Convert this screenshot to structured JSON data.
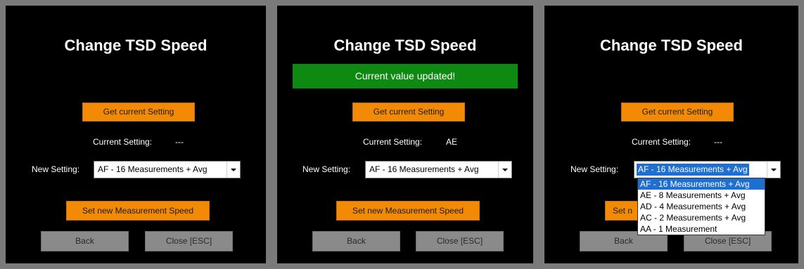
{
  "panels": [
    {
      "title": "Change TSD Speed",
      "get_button": "Get current Setting",
      "current_label": "Current Setting:",
      "current_value": "---",
      "new_label": "New Setting:",
      "selected": "AF - 16 Measurements + Avg",
      "set_button": "Set new Measurement Speed",
      "back_button": "Back",
      "close_button": "Close [ESC]"
    },
    {
      "title": "Change TSD Speed",
      "banner": "Current value updated!",
      "get_button": "Get current Setting",
      "current_label": "Current Setting:",
      "current_value": "AE",
      "new_label": "New Setting:",
      "selected": "AF - 16 Measurements + Avg",
      "set_button": "Set new Measurement Speed",
      "back_button": "Back",
      "close_button": "Close [ESC]"
    },
    {
      "title": "Change TSD Speed",
      "get_button": "Get current Setting",
      "current_label": "Current Setting:",
      "current_value": "---",
      "new_label": "New Setting:",
      "selected": "AF - 16 Measurements + Avg",
      "set_button_visible": "Set n",
      "back_button": "Back",
      "close_button": "Close [ESC]",
      "options": [
        "AF - 16 Measurements + Avg",
        "AE - 8 Measurements + Avg",
        "AD - 4 Measurements + Avg",
        "AC - 2 Measurements + Avg",
        "AA - 1 Measurement"
      ]
    }
  ],
  "colors": {
    "orange_button": "#f28a06",
    "gray_button": "#8a8a8a",
    "success_banner": "#0e8a12",
    "selection_blue": "#1f6fd1",
    "panel_bg": "#000000",
    "panel_border": "#7a7a7a"
  },
  "icons": {
    "dropdown_arrow": "chevron-down-icon"
  }
}
